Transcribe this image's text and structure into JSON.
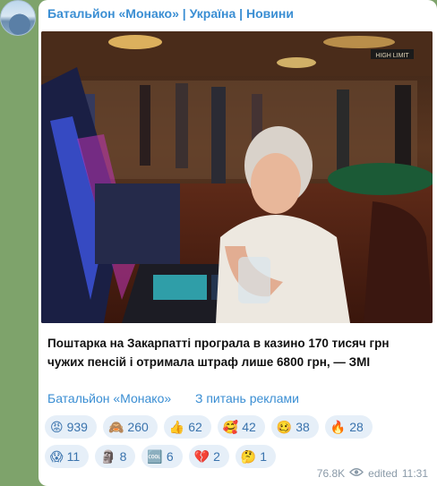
{
  "channel": {
    "title": "Батальйон «Монако» | Україна | Новини"
  },
  "post": {
    "caption": "Поштарка на Закарпатті програла в казино 170 тисяч грн чужих пенсій і отримала штраф лише 6800 грн, — ЗМІ",
    "link_channel": "Батальйон «Монако»",
    "link_ads": "З питань реклами",
    "image_sign": "HIGH LIMIT"
  },
  "reactions_row1": [
    {
      "icon": "angry-face-icon",
      "emoji": "😡",
      "count": "939"
    },
    {
      "icon": "see-no-evil-monkey-icon",
      "emoji": "🙈",
      "count": "260"
    },
    {
      "icon": "thumbs-up-icon",
      "emoji": "👍",
      "count": "62"
    },
    {
      "icon": "smiling-face-hearts-icon",
      "emoji": "🥰",
      "count": "42"
    },
    {
      "icon": "woozy-face-icon",
      "emoji": "🥴",
      "count": "38"
    },
    {
      "icon": "fire-icon",
      "emoji": "🔥",
      "count": "28"
    }
  ],
  "reactions_row2": [
    {
      "icon": "screaming-face-icon",
      "emoji": "😱",
      "count": "11"
    },
    {
      "icon": "moai-icon",
      "emoji": "🗿",
      "count": "8"
    },
    {
      "icon": "cool-button-icon",
      "emoji": "🆒",
      "count": "6"
    },
    {
      "icon": "broken-heart-icon",
      "emoji": "💔",
      "count": "2"
    },
    {
      "icon": "thinking-face-icon",
      "emoji": "🤔",
      "count": "1"
    }
  ],
  "meta": {
    "views": "76.8K",
    "edited": "edited",
    "time": "11:31"
  },
  "colors": {
    "accent": "#3a8ed3",
    "chat_bg": "#7ea36b",
    "reaction_bg": "#e6eff8"
  }
}
